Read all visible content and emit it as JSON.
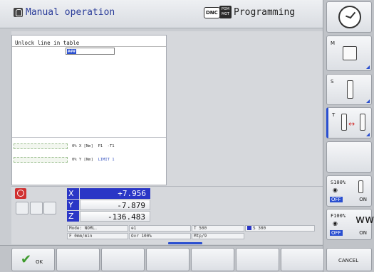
{
  "header": {
    "mode_title": "Manual operation",
    "mode_icon": "hand-icon",
    "dnc_badge": "DNC",
    "pgm_icon_text": "PGM MGT",
    "secondary_mode": "Programming"
  },
  "dialog": {
    "title": "Unlock line in table",
    "password_value": "###"
  },
  "load_bars": [
    {
      "pct": "0%",
      "axis": "X [Nm]",
      "p": "P1",
      "t": "-T1",
      "t_color": "#333333"
    },
    {
      "pct": "0%",
      "axis": "Y [Nm]",
      "p": "LIMIT 1",
      "t": "",
      "t_color": "#3a55c0"
    }
  ],
  "axes": [
    {
      "label": "X",
      "value": "+7.956",
      "highlight": true
    },
    {
      "label": "Y",
      "value": "-7.879",
      "highlight": false
    },
    {
      "label": "Z",
      "value": "-136.483",
      "highlight": false
    }
  ],
  "status": {
    "mode": "Mode: NOML.",
    "datum": "1",
    "tool": "T 500",
    "spindle": "S 300",
    "feed": "F 0mm/min",
    "ovr": "Ovr 100%",
    "mtp": "Mtp/9"
  },
  "side_keys": {
    "m_label": "M",
    "s_label": "S",
    "t_label": "T",
    "spindle_override": "S100%",
    "feed_override": "F100%",
    "off_label": "OFF",
    "on_label": "ON"
  },
  "soft_keys": {
    "ok_label": "OK",
    "cancel_label": "CANCEL"
  },
  "colors": {
    "accent": "#2a36c6",
    "title_text": "#2a3c99",
    "stop": "#d03030",
    "ok_check": "#3d9a2c"
  }
}
